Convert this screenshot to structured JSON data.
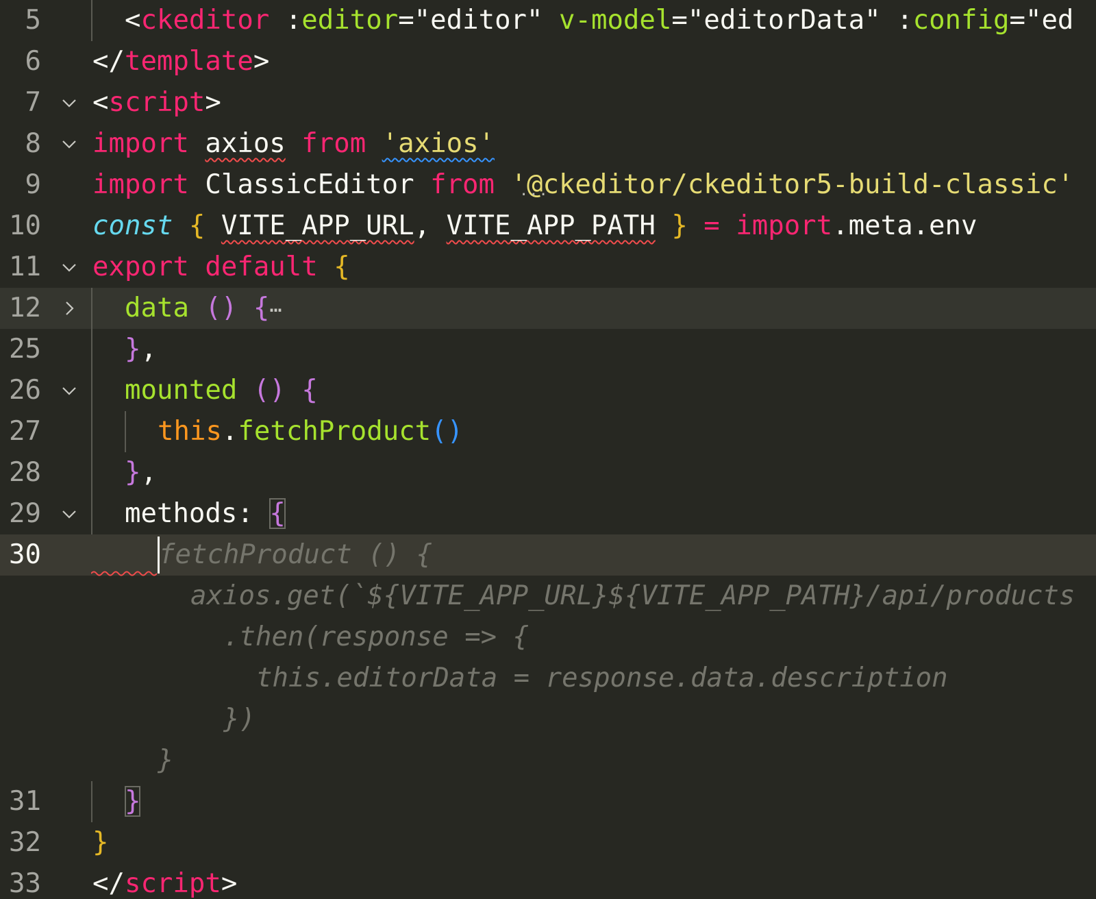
{
  "editor": {
    "theme_colors": {
      "background": "#272822",
      "keyword": "#f92672",
      "function": "#a6e22e",
      "string": "#e6db74",
      "storage": "#66d9ef",
      "this": "#fd971f",
      "ghost_text": "#75756c"
    },
    "folded_indicator": "⋯",
    "lines": [
      {
        "num": "5",
        "segments": [
          "<",
          "ckeditor",
          " :",
          "editor",
          "=",
          "\"editor\"",
          " ",
          "v-model",
          "=",
          "\"editorData\"",
          " :",
          "config",
          "=",
          "\"ed"
        ]
      },
      {
        "num": "6",
        "segments": [
          "</",
          "template",
          ">"
        ]
      },
      {
        "num": "7",
        "segments": [
          "<",
          "script",
          ">"
        ]
      },
      {
        "num": "8",
        "segments": [
          "import",
          " ",
          "axios",
          " ",
          "from",
          " ",
          "'axios'"
        ]
      },
      {
        "num": "9",
        "segments": [
          "import",
          " ClassicEditor ",
          "from",
          " ",
          "'@ckeditor/ckeditor5-build-classic'"
        ]
      },
      {
        "num": "10",
        "segments": [
          "const",
          " ",
          "{",
          " ",
          "VITE_APP_URL",
          ", ",
          "VITE_APP_PATH",
          " ",
          "}",
          " ",
          "=",
          " ",
          "import",
          ".meta.env"
        ]
      },
      {
        "num": "11",
        "segments": [
          "export",
          " ",
          "default",
          " ",
          "{"
        ]
      },
      {
        "num": "12",
        "segments": [
          "data",
          " ",
          "()",
          " ",
          "{"
        ]
      },
      {
        "num": "25",
        "segments": [
          "}",
          ","
        ]
      },
      {
        "num": "26",
        "segments": [
          "mounted",
          " ",
          "()",
          " ",
          "{"
        ]
      },
      {
        "num": "27",
        "segments": [
          "this",
          ".",
          "fetchProduct",
          "()"
        ]
      },
      {
        "num": "28",
        "segments": [
          "}",
          ","
        ]
      },
      {
        "num": "29",
        "segments": [
          "methods: ",
          "{"
        ]
      },
      {
        "num": "30",
        "segments": [
          "fetchProduct () {"
        ]
      },
      {
        "num": "31",
        "segments": [
          "}"
        ]
      },
      {
        "num": "32",
        "segments": [
          "}"
        ]
      },
      {
        "num": "33",
        "segments": [
          "</",
          "script",
          ">"
        ]
      }
    ],
    "ghost_lines": [
      "axios.get(`${VITE_APP_URL}${VITE_APP_PATH}/api/products",
      ".then(response => {",
      "this.editorData = response.data.description",
      "})",
      "}"
    ],
    "hint_dots": "..."
  }
}
